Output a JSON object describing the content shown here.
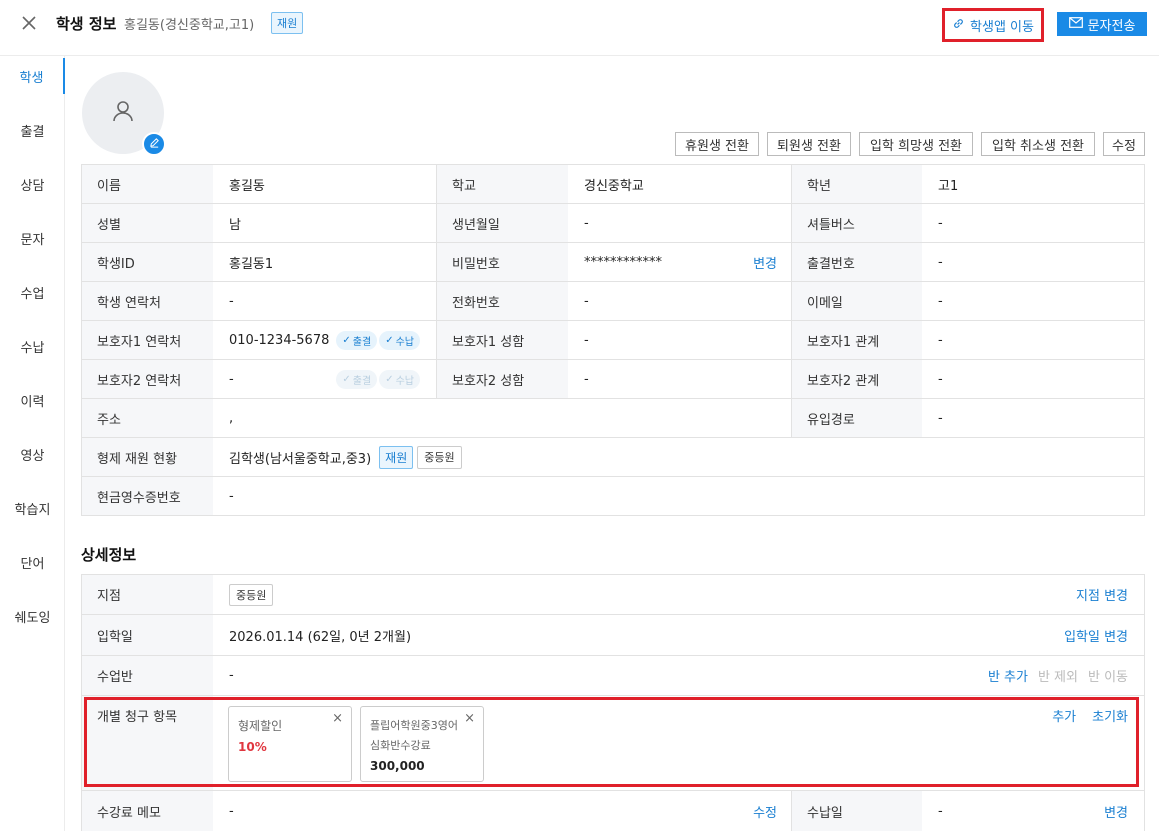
{
  "header": {
    "title": "학생 정보",
    "subtitle": "홍길동(경신중학교,고1)",
    "status_badge": "재원",
    "app_link_label": "학생앱 이동",
    "sms_label": "문자전송"
  },
  "sidebar": {
    "items": [
      {
        "label": "학생"
      },
      {
        "label": "출결"
      },
      {
        "label": "상담"
      },
      {
        "label": "문자"
      },
      {
        "label": "수업"
      },
      {
        "label": "수납"
      },
      {
        "label": "이력"
      },
      {
        "label": "영상"
      },
      {
        "label": "학습지"
      },
      {
        "label": "단어"
      },
      {
        "label": "쉐도잉"
      }
    ]
  },
  "actions": {
    "leave": "휴원생 전환",
    "withdraw": "퇴원생 전환",
    "hope": "입학 희망생 전환",
    "cancel": "입학 취소생 전환",
    "edit": "수정"
  },
  "info": {
    "name_label": "이름",
    "name": "홍길동",
    "school_label": "학교",
    "school": "경신중학교",
    "grade_label": "학년",
    "grade": "고1",
    "gender_label": "성별",
    "gender": "남",
    "birth_label": "생년월일",
    "birth": "-",
    "bus_label": "셔틀버스",
    "bus": "-",
    "id_label": "학생ID",
    "id": "홍길동1",
    "pw_label": "비밀번호",
    "pw": "************",
    "pw_change": "변경",
    "att_no_label": "출결번호",
    "att_no": "-",
    "contact_label": "학생 연락처",
    "contact": "-",
    "phone_label": "전화번호",
    "phone": "-",
    "email_label": "이메일",
    "email": "-",
    "g1_contact_label": "보호자1 연락처",
    "g1_contact": "010-1234-5678",
    "g1_name_label": "보호자1 성함",
    "g1_name": "-",
    "g1_rel_label": "보호자1 관계",
    "g1_rel": "-",
    "g2_contact_label": "보호자2 연락처",
    "g2_contact": "-",
    "g2_name_label": "보호자2 성함",
    "g2_name": "-",
    "g2_rel_label": "보호자2 관계",
    "g2_rel": "-",
    "address_label": "주소",
    "address": ",",
    "source_label": "유입경로",
    "source": "-",
    "sibling_label": "형제 재원 현황",
    "sibling": "김학생(남서울중학교,중3)",
    "sibling_badge1": "재원",
    "sibling_badge2": "중등원",
    "receipt_label": "현금영수증번호",
    "receipt": "-",
    "pill_att": "출결",
    "pill_pay": "수납"
  },
  "detail": {
    "section_title": "상세정보",
    "branch_label": "지점",
    "branch": "중등원",
    "branch_change": "지점 변경",
    "enroll_label": "입학일",
    "enroll": "2026.01.14 (62일, 0년 2개월)",
    "enroll_change": "입학일 변경",
    "class_label": "수업반",
    "class": "-",
    "class_add": "반 추가",
    "class_remove": "반 제외",
    "class_move": "반 이동",
    "billing_label": "개별 청구 항목",
    "billing_add": "추가",
    "billing_reset": "초기화",
    "billing_items": [
      {
        "name": "형제할인",
        "name2": "",
        "amount": "10%"
      },
      {
        "name": "플립어학원중3영어",
        "name2": "심화반수강료",
        "amount": "300,000"
      }
    ],
    "memo_label": "수강료 메모",
    "memo": "-",
    "memo_edit": "수정",
    "payday_label": "수납일",
    "payday": "-",
    "payday_change": "변경"
  },
  "colors": {
    "accent": "#1a8ae6",
    "highlight": "#e0202a",
    "discount": "#e0363f"
  }
}
